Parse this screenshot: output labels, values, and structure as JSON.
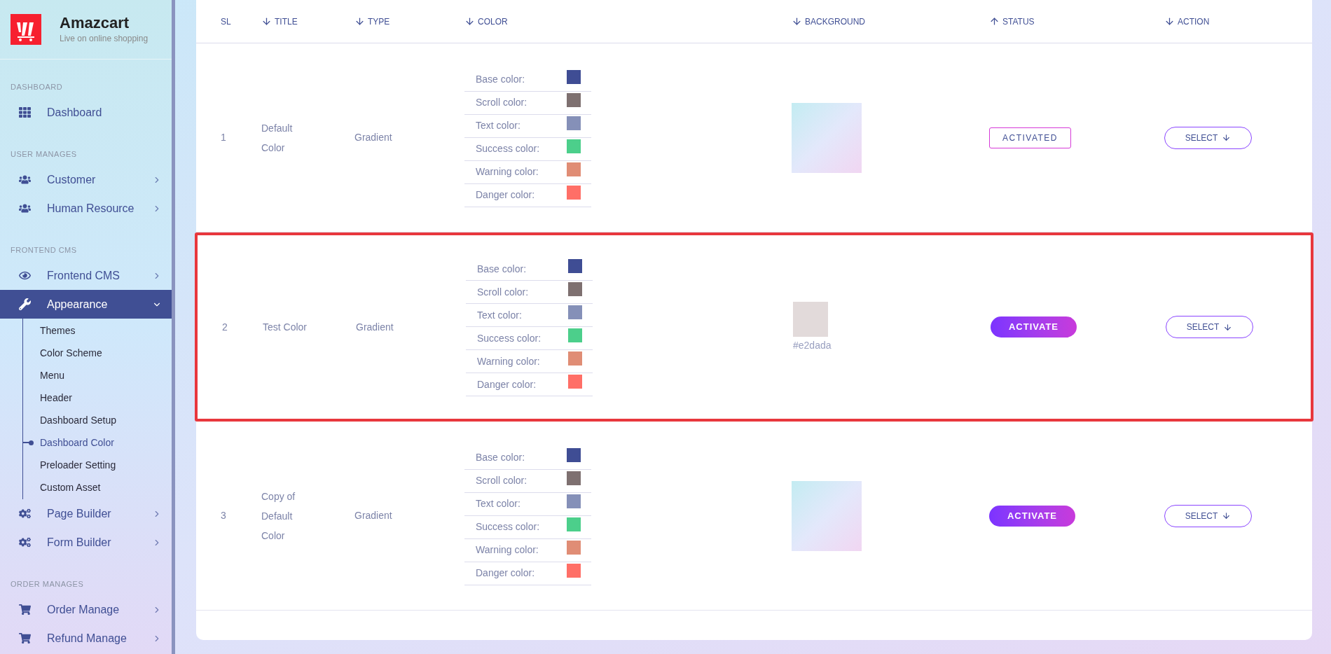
{
  "brand": {
    "name": "Amazcart",
    "tagline": "Live on online shopping"
  },
  "sidebar": {
    "sections": [
      {
        "title": "DASHBOARD",
        "items": [
          {
            "kind": "grid",
            "label": "Dashboard",
            "has_children": false,
            "selected": false
          }
        ]
      },
      {
        "title": "USER MANAGES",
        "items": [
          {
            "kind": "users",
            "label": "Customer",
            "has_children": true,
            "expanded": false,
            "selected": false
          },
          {
            "kind": "users",
            "label": "Human Resource",
            "has_children": true,
            "expanded": false,
            "selected": false
          }
        ]
      },
      {
        "title": "FRONTEND CMS",
        "items": [
          {
            "kind": "eye",
            "label": "Frontend CMS",
            "has_children": true,
            "expanded": false,
            "selected": false
          },
          {
            "kind": "wrench",
            "label": "Appearance",
            "has_children": true,
            "expanded": true,
            "selected": true,
            "children": [
              {
                "label": "Themes",
                "selected": false
              },
              {
                "label": "Color Scheme",
                "selected": false
              },
              {
                "label": "Menu",
                "selected": false
              },
              {
                "label": "Header",
                "selected": false
              },
              {
                "label": "Dashboard Setup",
                "selected": false
              },
              {
                "label": "Dashboard Color",
                "selected": true
              },
              {
                "label": "Preloader Setting",
                "selected": false
              },
              {
                "label": "Custom Asset",
                "selected": false
              }
            ]
          },
          {
            "kind": "gears",
            "label": "Page Builder",
            "has_children": true,
            "expanded": false,
            "selected": false
          },
          {
            "kind": "gears",
            "label": "Form Builder",
            "has_children": true,
            "expanded": false,
            "selected": false
          }
        ]
      },
      {
        "title": "ORDER MANAGES",
        "items": [
          {
            "kind": "cart",
            "label": "Order Manage",
            "has_children": true,
            "expanded": false,
            "selected": false
          },
          {
            "kind": "cart",
            "label": "Refund Manage",
            "has_children": true,
            "expanded": false,
            "selected": false
          }
        ]
      }
    ]
  },
  "table": {
    "columns": [
      {
        "label": "SL",
        "sortable": false
      },
      {
        "label": "TITLE",
        "sortable": true,
        "ascending": false
      },
      {
        "label": "TYPE",
        "sortable": true,
        "ascending": false
      },
      {
        "label": "COLOR",
        "sortable": true,
        "ascending": false
      },
      {
        "label": "BACKGROUND",
        "sortable": true,
        "ascending": false
      },
      {
        "label": "STATUS",
        "sortable": true,
        "ascending": true
      },
      {
        "label": "ACTION",
        "sortable": true,
        "ascending": false
      }
    ],
    "rows": [
      {
        "sl": "1",
        "title": "Default Color",
        "type": "Gradient",
        "highlighted": false,
        "colors": [
          {
            "label": "Base color:",
            "color": "#3f4d94"
          },
          {
            "label": "Scroll color:",
            "color": "#7e7070"
          },
          {
            "label": "Text color:",
            "color": "#8590b8"
          },
          {
            "label": "Success color:",
            "color": "#4ccf8b"
          },
          {
            "label": "Warning color:",
            "color": "#e08d75"
          },
          {
            "label": "Danger color:",
            "color": "#ff6f67"
          }
        ],
        "background": {
          "kind": "image"
        },
        "status": {
          "label": "ACTIVATED",
          "active": true
        },
        "action": "SELECT"
      },
      {
        "sl": "2",
        "title": "Test Color",
        "type": "Gradient",
        "highlighted": true,
        "colors": [
          {
            "label": "Base color:",
            "color": "#3f4d94"
          },
          {
            "label": "Scroll color:",
            "color": "#7e7070"
          },
          {
            "label": "Text color:",
            "color": "#8590b8"
          },
          {
            "label": "Success color:",
            "color": "#4ccf8b"
          },
          {
            "label": "Warning color:",
            "color": "#e08d75"
          },
          {
            "label": "Danger color:",
            "color": "#ff6f67"
          }
        ],
        "background": {
          "kind": "color",
          "color": "#e2dada",
          "value": "#e2dada"
        },
        "status": {
          "label": "ACTIVATE",
          "active": false
        },
        "action": "SELECT"
      },
      {
        "sl": "3",
        "title": "Copy of Default Color",
        "type": "Gradient",
        "highlighted": false,
        "colors": [
          {
            "label": "Base color:",
            "color": "#3f4d94"
          },
          {
            "label": "Scroll color:",
            "color": "#7e7070"
          },
          {
            "label": "Text color:",
            "color": "#8590b8"
          },
          {
            "label": "Success color:",
            "color": "#4ccf8b"
          },
          {
            "label": "Warning color:",
            "color": "#e08d75"
          },
          {
            "label": "Danger color:",
            "color": "#ff6f67"
          }
        ],
        "background": {
          "kind": "image"
        },
        "status": {
          "label": "ACTIVATE",
          "active": false
        },
        "action": "SELECT"
      }
    ]
  }
}
